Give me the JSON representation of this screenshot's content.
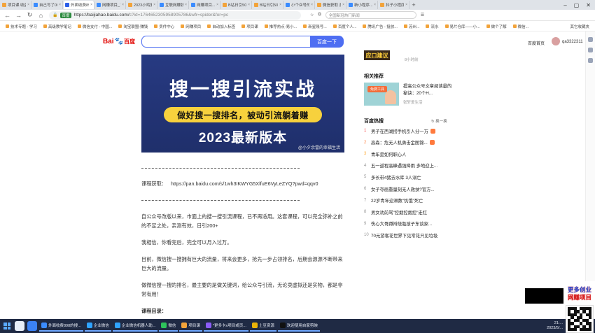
{
  "browser": {
    "tabs": [
      {
        "label": "项目课 收益与文章",
        "color": "#f2a33a",
        "active": false
      },
      {
        "label": "自己写了000副...",
        "color": "#3b8cff",
        "active": false
      },
      {
        "label": "外面收费898的...",
        "color": "#2b5ee8",
        "active": true
      },
      {
        "label": "网赚项目_百度...",
        "color": "#3b8cff",
        "active": false
      },
      {
        "label": "2023小鸡爱的...",
        "color": "#f2a33a",
        "active": false
      },
      {
        "label": "互联网赚钱文...",
        "color": "#3b8cff",
        "active": false
      },
      {
        "label": "网赚项目...",
        "color": "#3b8cff",
        "active": false
      },
      {
        "label": "B站日引50+...",
        "color": "#f2a33a",
        "active": false
      },
      {
        "label": "B站日引50+...",
        "color": "#f2a33a",
        "active": false
      },
      {
        "label": "小个众号的...",
        "color": "#3b8cff",
        "active": false
      },
      {
        "label": "微信获取 游戏...",
        "color": "#f2a33a",
        "active": false
      },
      {
        "label": "新小程序...",
        "color": "#3b8cff",
        "active": false
      },
      {
        "label": "抖子小程序引...",
        "color": "#f2a33a",
        "active": false
      }
    ],
    "new_tab": "+",
    "url_site_badge": "百度",
    "url_main": "https://baijiahao.baidu.com/",
    "url_rest": "s?id=1764652305958905786&wfr=spider&for=pc",
    "toolbar_search_placeholder": "全国新冠热门新闻",
    "bookmarks": [
      "技术专题 - 学习",
      "高级教学笔记",
      "微信支付 - 中国...",
      "淘宝联盟-赚钱",
      "卖件中心",
      "网赚项目",
      "自动加入标签",
      "项目课",
      "推荐热点-易小...",
      "新星账号...",
      "百度个人...",
      "腾讯广告 - 投放...",
      "苏州...",
      "流水",
      "易片仓库——小...",
      "做个了解",
      "微信..."
    ],
    "bookmark_other": "其它收藏夹"
  },
  "header": {
    "logo_bai": "Bai",
    "logo_paw": "🐾",
    "logo_du": "百度",
    "search_button": "百度一下",
    "home_link": "百度首页",
    "username": "qa3322311"
  },
  "article": {
    "banner": {
      "headline": "搜一搜引流实战",
      "pill": "做好搜一搜排名，被动引流躺着赚",
      "edition": "2023最新版本",
      "watermark": "@小夕余雷的幸福生活"
    },
    "dash_line": "-------------------------------------------------------------------------------------------------------",
    "course_link_label": "课程获取：",
    "course_link_url": "https://pan.baidu.com/s/1wh3IKWYG5XlfuE6VyLeZYQ?pwd=qqv0",
    "paragraphs": [
      "自公众号改版以来，市面上的搜一搜引流课程，已不再适用。这套课程，可以完全弥补之前的不足之处，亲测有效，日引200+",
      "我相信，你看完后，完全可以月入过万。",
      "目前，微信搜一搜拥有巨大的流量，将来会更多，抢先一步占领排名，后期会源源不断带来巨大的流量。",
      "做微信搜一搜的排名，最主要的是做关键词，给公众号引流，无论卖虚拟还是实物，都是非常有用！"
    ],
    "catalog_title": "课程目录："
  },
  "sidebar": {
    "top_thumb_text": "应口建议",
    "top_thumb_sub": "8小时前",
    "related_title": "相关推荐",
    "related_item": {
      "thumb_label": "免费工具",
      "title": "提高公众号文章阅读量的秘诀：20个H...",
      "source": "张轩爱生活"
    },
    "hot_title": "百度热搜",
    "refresh": "换一换",
    "hot_items": [
      {
        "num": "1",
        "title": "男子在西湖捞手机引人分一万"
      },
      {
        "num": "2",
        "title": "高森：危无人机勇击金图锦..."
      },
      {
        "num": "3",
        "title": "青年是如何职心人"
      },
      {
        "num": "4",
        "title": "五一返程高峰遇强降雨 多地迎上..."
      },
      {
        "num": "5",
        "title": "多长带4猪去水库 3人溺亡"
      },
      {
        "num": "6",
        "title": "女子夺画重量刻无人救扶?官方..."
      },
      {
        "num": "7",
        "title": "22岁青年迎淋数\"饥饿\"死亡"
      },
      {
        "num": "8",
        "title": "男女劝前骂\"控烟控烟控\"走红"
      },
      {
        "num": "9",
        "title": "伤心大哥蹲辩烧瓶孩子东谈家..."
      },
      {
        "num": "10",
        "title": "70元游客花世界下见常花只见垃圾"
      }
    ]
  },
  "overlays": {
    "promo_line1": "更多创业",
    "promo_line2": "网赚项目"
  },
  "taskbar": {
    "apps": [
      {
        "label": "外面收费898的搜...",
        "color": "#3b8cff"
      },
      {
        "label": "企业微信",
        "color": "#2fa3ff"
      },
      {
        "label": "企业微信机器人助...",
        "color": "#2fa3ff"
      },
      {
        "label": "微信",
        "color": "#2ec35b"
      },
      {
        "label": "项目课",
        "color": "#f2a33a"
      },
      {
        "label": "*更多卡x项目或页...",
        "color": "#8b5cf6"
      },
      {
        "label": "土豆资源",
        "color": "#eab308"
      },
      {
        "label": "欢迎使用自家剪映",
        "color": "#111111"
      }
    ],
    "time": "21:...",
    "date": "2023/5/..."
  }
}
